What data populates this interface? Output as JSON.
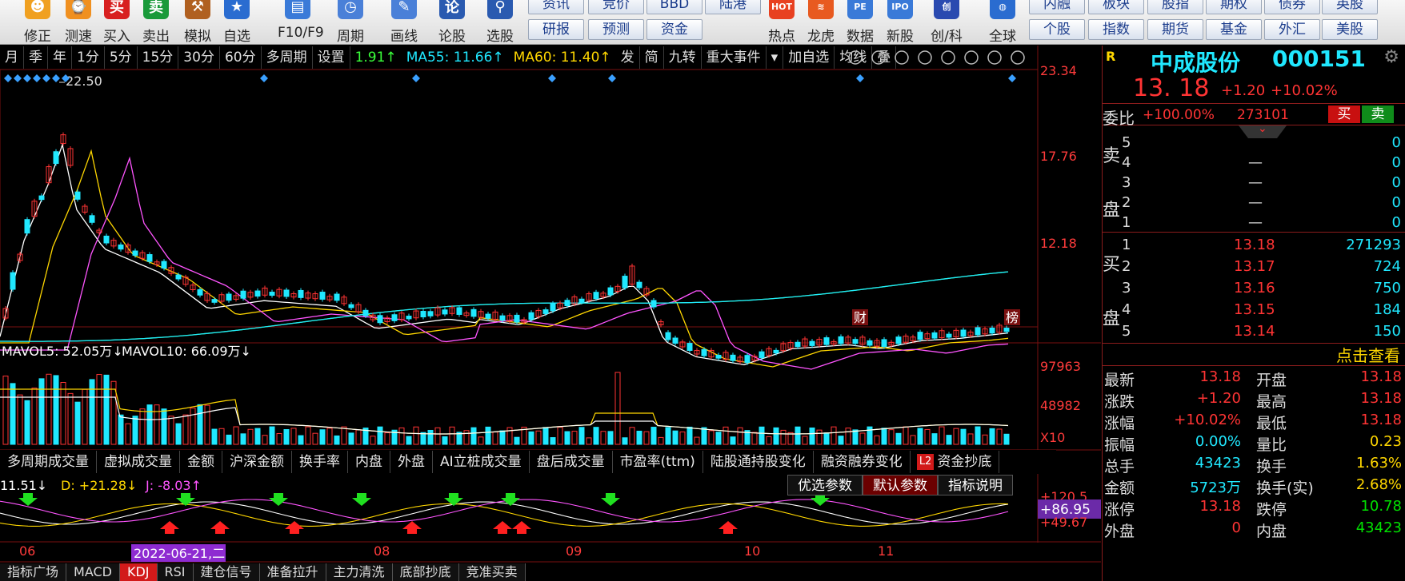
{
  "toolbar": {
    "items": [
      {
        "label": "修正",
        "icon": "correct-icon",
        "glyph": "☻"
      },
      {
        "label": "测速",
        "icon": "speed-test-icon",
        "glyph": "⌚"
      },
      {
        "label": "买入",
        "icon": "buy-icon",
        "glyph": "买"
      },
      {
        "label": "卖出",
        "icon": "sell-icon",
        "glyph": "卖"
      },
      {
        "label": "模拟",
        "icon": "simulate-icon",
        "glyph": "⚒"
      },
      {
        "label": "自选",
        "icon": "watchlist-icon",
        "glyph": "★"
      },
      {
        "label": "F10/F9",
        "icon": "f10-icon",
        "glyph": "▤"
      },
      {
        "label": "周期",
        "icon": "period-icon",
        "glyph": "◷"
      },
      {
        "label": "画线",
        "icon": "draw-line-icon",
        "glyph": "✎"
      },
      {
        "label": "论股",
        "icon": "forum-icon",
        "glyph": "论"
      },
      {
        "label": "选股",
        "icon": "stock-pick-icon",
        "glyph": "⚲"
      }
    ],
    "group_row1": [
      "研报",
      "预测",
      "资金"
    ],
    "group_row1_top": [
      "资讯",
      "竞价",
      "BBD",
      "陆港"
    ],
    "group_row2_items": [
      {
        "label": "热点",
        "icon": "hot-icon",
        "glyph": "HOT"
      },
      {
        "label": "龙虎",
        "icon": "dragon-tiger-icon",
        "glyph": "≋"
      },
      {
        "label": "数据",
        "icon": "data-icon",
        "glyph": "PE"
      },
      {
        "label": "新股",
        "icon": "ipo-icon",
        "glyph": "IPO"
      },
      {
        "label": "创/科",
        "icon": "growth-board-icon",
        "glyph": "创"
      },
      {
        "label": "全球",
        "icon": "globe-icon",
        "glyph": "◍"
      }
    ],
    "right_top": [
      "内融",
      "板块",
      "股指",
      "期权",
      "债券",
      "英股"
    ],
    "right_bottom": [
      "个股",
      "指数",
      "期货",
      "基金",
      "外汇",
      "美股"
    ]
  },
  "periodbar": {
    "items": [
      "月",
      "季",
      "年",
      "1分",
      "5分",
      "15分",
      "30分",
      "60分",
      "多周期",
      "设置"
    ],
    "ma_value": "1.91↑",
    "ma55": "MA55: 11.66↑",
    "ma60": "MA60: 11.40↑",
    "extra": [
      "发",
      "简",
      "九转",
      "重大事件"
    ],
    "extra2": [
      "加自选",
      "均线",
      "叠"
    ]
  },
  "main_chart": {
    "price_labels": [
      "23.34",
      "17.76",
      "12.18"
    ],
    "peak_label": "22.50",
    "markers": [
      "财",
      "榜"
    ]
  },
  "volume_chart": {
    "mavol5": "MAVOL5: 52.05万↓",
    "mavol10": "MAVOL10: 66.09万↓",
    "axis_labels": [
      "97963",
      "48982",
      "X10"
    ]
  },
  "indicator_tabs": [
    "多周期成交量",
    "虚拟成交量",
    "金额",
    "沪深金额",
    "换手率",
    "内盘",
    "外盘",
    "AI立桩成交量",
    "盘后成交量",
    "市盈率(ttm)",
    "陆股通持股变化",
    "融资融券变化"
  ],
  "indicator_l2": "L2",
  "indicator_last": "资金抄底",
  "kdj": {
    "k_text": "11.51↓",
    "d_text": "D: +21.28↓",
    "j_text": "J: -8.03↑",
    "axis_top": "+120.5",
    "axis_val": "+86.95",
    "axis_low": "+49.67",
    "params": [
      "优选参数",
      "默认参数",
      "指标说明"
    ]
  },
  "date_axis": {
    "labels": [
      "06",
      "08",
      "09",
      "10",
      "11"
    ],
    "cursor_date": "2022-06-21,二"
  },
  "bottom_tabs": [
    "指标广场",
    "MACD",
    "KDJ",
    "RSI",
    "建仓信号",
    "准备拉升",
    "主力清洗",
    "底部抄底",
    "竞准买卖"
  ],
  "bottom_active": "KDJ",
  "quote": {
    "badge": "R",
    "name": "中成股份",
    "code": "000151",
    "price": "13. 18",
    "change": "+1.20",
    "change_pct": "+10.02%",
    "weibi_label": "委比",
    "weibi_pct": "+100.00%",
    "weibi_diff": "273101",
    "buy_btn": "买",
    "sell_btn": "卖",
    "sell_label": "卖盘",
    "buy_label": "买盘",
    "sell_orders": [
      {
        "level": "5",
        "price": "",
        "vol": "0"
      },
      {
        "level": "4",
        "price": "—",
        "vol": "0"
      },
      {
        "level": "3",
        "price": "—",
        "vol": "0"
      },
      {
        "level": "2",
        "price": "—",
        "vol": "0"
      },
      {
        "level": "1",
        "price": "—",
        "vol": "0"
      }
    ],
    "buy_orders": [
      {
        "level": "1",
        "price": "13.18",
        "vol": "271293"
      },
      {
        "level": "2",
        "price": "13.17",
        "vol": "724"
      },
      {
        "level": "3",
        "price": "13.16",
        "vol": "750"
      },
      {
        "level": "4",
        "price": "13.15",
        "vol": "184"
      },
      {
        "level": "5",
        "price": "13.14",
        "vol": "150"
      }
    ],
    "click_view": "点击查看",
    "stats_left": [
      {
        "label": "最新",
        "value": "13.18",
        "color": "#ff3434"
      },
      {
        "label": "涨跌",
        "value": "+1.20",
        "color": "#ff3434"
      },
      {
        "label": "涨幅",
        "value": "+10.02%",
        "color": "#ff3434"
      },
      {
        "label": "振幅",
        "value": "0.00%",
        "color": "#20e8ff"
      },
      {
        "label": "总手",
        "value": "43423",
        "color": "#20e8ff"
      },
      {
        "label": "金额",
        "value": "5723万",
        "color": "#20e8ff"
      },
      {
        "label": "涨停",
        "value": "13.18",
        "color": "#ff3434"
      },
      {
        "label": "外盘",
        "value": "0",
        "color": "#ff3434"
      }
    ],
    "stats_right": [
      {
        "label": "开盘",
        "value": "13.18",
        "color": "#ff3434"
      },
      {
        "label": "最高",
        "value": "13.18",
        "color": "#ff3434"
      },
      {
        "label": "最低",
        "value": "13.18",
        "color": "#ff3434"
      },
      {
        "label": "量比",
        "value": "0.23",
        "color": "#ffd700"
      },
      {
        "label": "换手",
        "value": "1.63%",
        "color": "#ffd700"
      },
      {
        "label": "换手(实)",
        "value": "2.68%",
        "color": "#ffd700"
      },
      {
        "label": "跌停",
        "value": "10.78",
        "color": "#00e000"
      },
      {
        "label": "内盘",
        "value": "43423",
        "color": "#00e000"
      }
    ]
  }
}
